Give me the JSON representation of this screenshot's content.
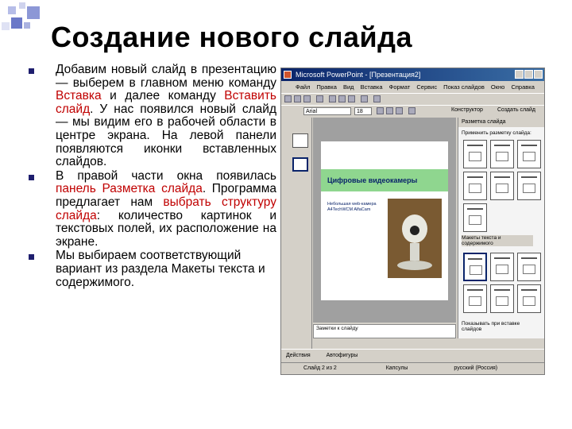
{
  "title": "Создание нового слайда",
  "bullets": {
    "b1": {
      "p1": "Добавим новый слайд в презентацию — выберем в главном меню команду ",
      "h1": "Вставка",
      "p2": " и далее команду ",
      "h2": "Вставить слайд",
      "p3": ". У нас появился новый слайд — мы видим его в рабочей области в центре экрана. На левой панели появляются иконки вставленных слайдов."
    },
    "b2": {
      "p1": "В правой части окна появилась ",
      "h1": "панель Разметка слайда",
      "p2": ". Программа предлагает нам ",
      "h2": "выбрать структуру слайда",
      "p3": ": количество картинок и текстовых полей, их расположение на экране."
    },
    "b3": {
      "p1": "Мы выбираем соответствующий вариант из раздела Макеты текста и содержимого."
    }
  },
  "screenshot": {
    "window_title": "Microsoft PowerPoint - [Презентация2]",
    "menu": [
      "Файл",
      "Правка",
      "Вид",
      "Вставка",
      "Формат",
      "Сервис",
      "Показ слайдов",
      "Окно",
      "Справка"
    ],
    "font_name": "Arial",
    "font_size": "18",
    "designer_label": "Конструктор",
    "create_slide_label": "Создать слайд",
    "task_pane_title": "Разметка слайда",
    "apply_layout_label": "Применить разметку слайда:",
    "layouts_section_label": "Макеты текста и содержимого",
    "show_on_insert_label": "Показывать при вставке слайдов",
    "slide_title": "Цифровые видеокамеры",
    "slide_bullet": "Небольшая web-камера A4TechWCM AlfaCam",
    "notes_placeholder": "Заметки к слайду",
    "draw_actions": "Действия",
    "autoshapes": "Автофигуры",
    "status_slide": "Слайд 2 из 2",
    "status_design": "Капсулы",
    "status_lang": "русский (Россия)",
    "colors": {
      "bullet": "#1e1e6e",
      "highlight": "#c00000",
      "titlebar": "#0a246a",
      "slide_band": "#8fd68f"
    }
  }
}
